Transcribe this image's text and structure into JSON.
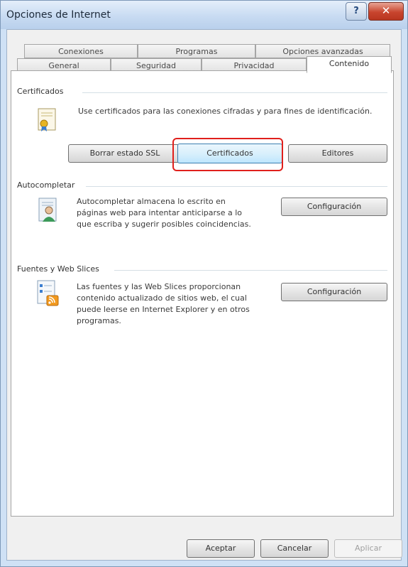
{
  "window": {
    "title": "Opciones de Internet"
  },
  "tabs_back": [
    {
      "label": "Conexiones"
    },
    {
      "label": "Programas"
    },
    {
      "label": "Opciones avanzadas"
    }
  ],
  "tabs_front": [
    {
      "label": "General"
    },
    {
      "label": "Seguridad"
    },
    {
      "label": "Privacidad"
    },
    {
      "label": "Contenido",
      "active": true
    }
  ],
  "certificates": {
    "title": "Certificados",
    "description": "Use certificados para las conexiones cifradas y para fines de identificación.",
    "buttons": {
      "clear_ssl": "Borrar estado SSL",
      "certificates": "Certificados",
      "publishers": "Editores"
    }
  },
  "autocomplete": {
    "title": "Autocompletar",
    "description": "Autocompletar almacena lo escrito en páginas web para intentar anticiparse a lo que escriba y sugerir posibles coincidencias.",
    "settings_button": "Configuración"
  },
  "feeds": {
    "title": "Fuentes y Web Slices",
    "description": "Las fuentes y las Web Slices proporcionan contenido actualizado de sitios web, el cual puede leerse en Internet Explorer y en otros programas.",
    "settings_button": "Configuración"
  },
  "footer": {
    "ok": "Aceptar",
    "cancel": "Cancelar",
    "apply": "Aplicar"
  }
}
